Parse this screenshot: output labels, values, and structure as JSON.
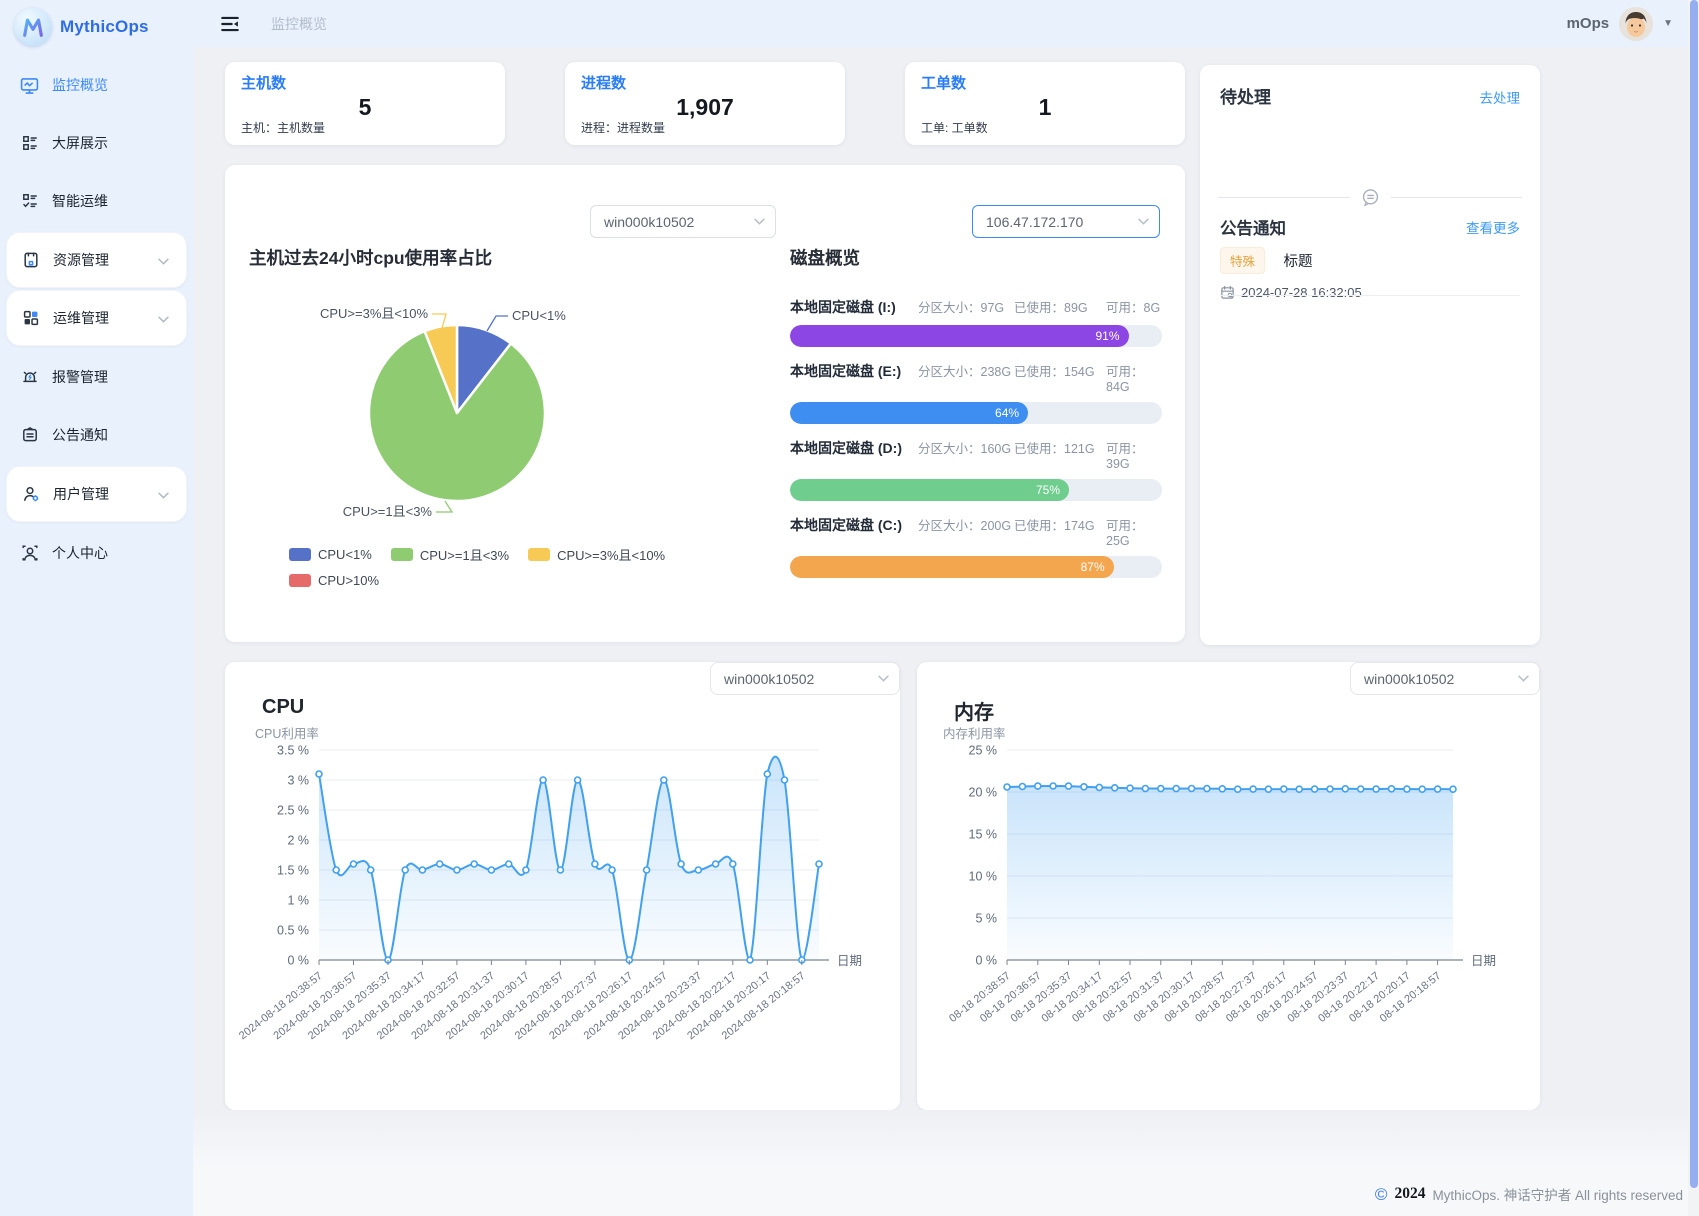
{
  "brand": "MythicOps",
  "header": {
    "breadcrumb": "监控概览",
    "username": "mOps"
  },
  "sidebar": {
    "items": [
      {
        "label": "监控概览"
      },
      {
        "label": "大屏展示"
      },
      {
        "label": "智能运维"
      },
      {
        "label": "资源管理"
      },
      {
        "label": "运维管理"
      },
      {
        "label": "报警管理"
      },
      {
        "label": "公告通知"
      },
      {
        "label": "用户管理"
      },
      {
        "label": "个人中心"
      }
    ]
  },
  "stats": [
    {
      "title": "主机数",
      "value": "5",
      "desc": "主机：主机数量"
    },
    {
      "title": "进程数",
      "value": "1,907",
      "desc": "进程：进程数量"
    },
    {
      "title": "工单数",
      "value": "1",
      "desc": "工单: 工单数"
    }
  ],
  "selectors": {
    "pie_host": "win000k10502",
    "disk_ip": "106.47.172.170",
    "cpu_host": "win000k10502",
    "mem_host": "win000k10502"
  },
  "disks": {
    "title": "磁盘概览",
    "items": [
      {
        "name": "本地固定磁盘 (I:)",
        "size": "分区大小：97G",
        "used": "已使用：89G",
        "free": "可用：8G",
        "percent": 91,
        "percent_label": "91%",
        "color": "#8b46e4"
      },
      {
        "name": "本地固定磁盘 (E:)",
        "size": "分区大小：238G",
        "used": "已使用：154G",
        "free": "可用：84G",
        "percent": 64,
        "percent_label": "64%",
        "color": "#3d8ef0"
      },
      {
        "name": "本地固定磁盘 (D:)",
        "size": "分区大小：160G",
        "used": "已使用：121G",
        "free": "可用：39G",
        "percent": 75,
        "percent_label": "75%",
        "color": "#6fce8e"
      },
      {
        "name": "本地固定磁盘 (C:)",
        "size": "分区大小：200G",
        "used": "已使用：174G",
        "free": "可用：25G",
        "percent": 87,
        "percent_label": "87%",
        "color": "#f4a64f"
      }
    ]
  },
  "todo": {
    "title": "待处理",
    "action": "去处理"
  },
  "notice": {
    "title": "公告通知",
    "action": "查看更多",
    "tag": "特殊",
    "item_title": "标题",
    "time": "2024-07-28 16:32:05"
  },
  "footer": {
    "copyright_symbol": "©",
    "year": "2024",
    "text": "MythicOps. 神话守护者 All rights reserved"
  },
  "chart_data": {
    "pie": {
      "type": "pie",
      "title": "主机过去24小时cpu使用率占比",
      "legend_position": "bottom",
      "series": [
        {
          "name": "CPU<1%",
          "value": 10.5,
          "color": "#5571c8"
        },
        {
          "name": "CPU>=1且<3%",
          "value": 83.5,
          "color": "#8ecb71"
        },
        {
          "name": "CPU>=3%且<10%",
          "value": 6.0,
          "color": "#f6ca55"
        },
        {
          "name": "CPU>10%",
          "value": 0,
          "color": "#e56a6a"
        }
      ]
    },
    "cpu": {
      "type": "line",
      "title": "CPU",
      "ylabel": "CPU利用率",
      "xlabel": "日期",
      "ylim": [
        0,
        3.5
      ],
      "ytick_step": 0.5,
      "grid": true,
      "color": "#41a0f0",
      "x": [
        "2024-08-18 20:38:57",
        "2024-08-18 20:36:57",
        "2024-08-18 20:35:37",
        "2024-08-18 20:34:17",
        "2024-08-18 20:32:57",
        "2024-08-18 20:31:37",
        "2024-08-18 20:30:17",
        "2024-08-18 20:28:57",
        "2024-08-18 20:27:37",
        "2024-08-18 20:26:17",
        "2024-08-18 20:24:57",
        "2024-08-18 20:23:37",
        "2024-08-18 20:22:17",
        "2024-08-18 20:20:17",
        "2024-08-18 20:18:57"
      ],
      "values": [
        3.1,
        1.5,
        1.6,
        1.5,
        0,
        1.5,
        1.5,
        1.6,
        1.5,
        1.6,
        1.5,
        1.6,
        1.5,
        3.0,
        1.5,
        3.0,
        1.6,
        1.5,
        0,
        1.5,
        3.0,
        1.6,
        1.5,
        1.6,
        1.6,
        0,
        3.1,
        3.0,
        0,
        1.6
      ]
    },
    "memory": {
      "type": "line",
      "title": "内存",
      "ylabel": "内存利用率",
      "xlabel": "日期",
      "ylim": [
        0,
        25
      ],
      "ytick_step": 5,
      "grid": true,
      "color": "#41a0f0",
      "x": [
        "08-18 20:38:57",
        "08-18 20:36:57",
        "08-18 20:35:37",
        "08-18 20:34:17",
        "08-18 20:32:57",
        "08-18 20:31:37",
        "08-18 20:30:17",
        "08-18 20:28:57",
        "08-18 20:27:37",
        "08-18 20:26:17",
        "08-18 20:24:57",
        "08-18 20:23:37",
        "08-18 20:22:17",
        "08-18 20:20:17",
        "08-18 20:18:57"
      ],
      "values": [
        20.6,
        20.65,
        20.7,
        20.72,
        20.7,
        20.62,
        20.55,
        20.5,
        20.45,
        20.42,
        20.4,
        20.4,
        20.42,
        20.4,
        20.38,
        20.33,
        20.35,
        20.33,
        20.35,
        20.33,
        20.35,
        20.36,
        20.38,
        20.36,
        20.35,
        20.38,
        20.35,
        20.33,
        20.35,
        20.33
      ]
    }
  }
}
